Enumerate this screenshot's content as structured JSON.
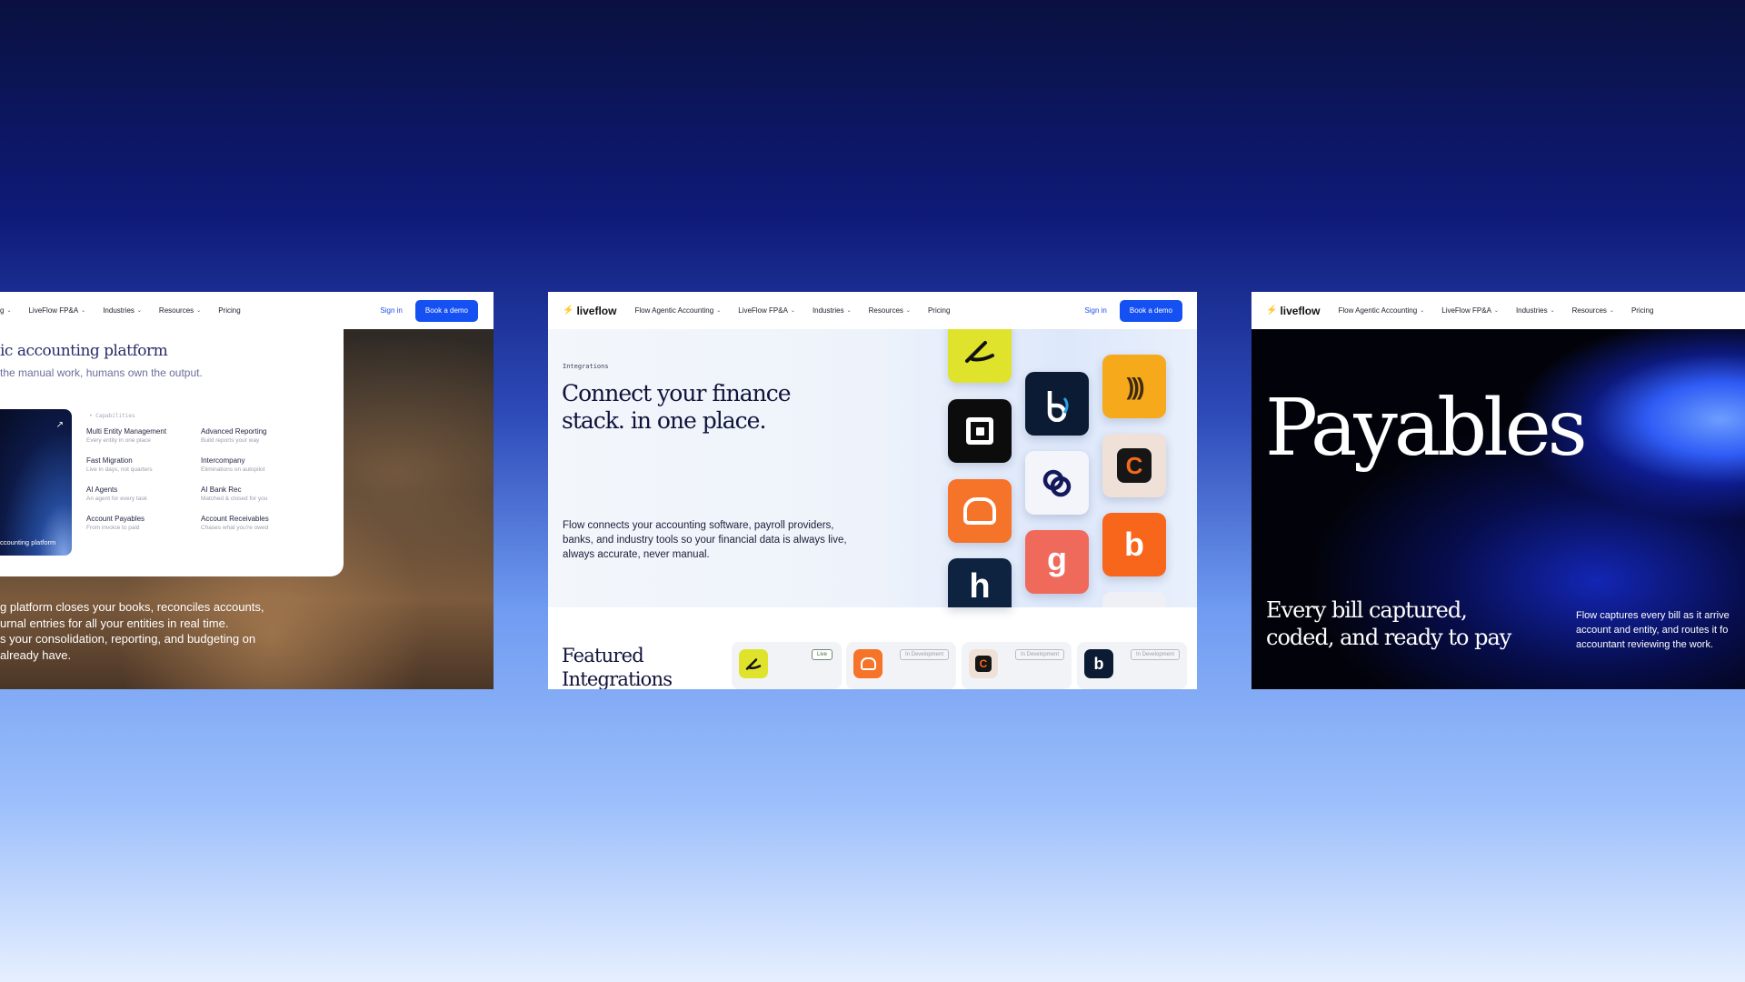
{
  "left_shot": {
    "nav": {
      "items": [
        "g",
        "LiveFlow FP&A",
        "Industries",
        "Resources",
        "Pricing"
      ],
      "signin": "Sign in",
      "cta": "Book a demo"
    },
    "menu": {
      "heading": "ic accounting platform",
      "subheading": "the manual work, humans own the output.",
      "section_label": "• Capabilities",
      "capabilities": [
        {
          "title": "Multi Entity Management",
          "sub": "Every entity in one place"
        },
        {
          "title": "Advanced Reporting",
          "sub": "Build reports your way"
        },
        {
          "title": "Fast Migration",
          "sub": "Live in days, not quarters"
        },
        {
          "title": "Intercompany",
          "sub": "Eliminations on autopilot"
        },
        {
          "title": "AI Agents",
          "sub": "An agent for every task"
        },
        {
          "title": "AI Bank Rec",
          "sub": "Matched & closed for you"
        },
        {
          "title": "Account Payables",
          "sub": "From invoice to paid"
        },
        {
          "title": "Account Receivables",
          "sub": "Chases what you're owed"
        }
      ],
      "promo_caption": "ccounting platform",
      "promo_icon": "arrow-up-right-icon"
    },
    "body_lines": [
      "g platform closes your books, reconciles accounts,",
      "urnal entries for all your entities in real time.",
      "s your consolidation, reporting, and budgeting on",
      "already have."
    ]
  },
  "center_shot": {
    "nav": {
      "logo": "liveflow",
      "items": [
        "Flow Agentic Accounting",
        "LiveFlow FP&A",
        "Industries",
        "Resources",
        "Pricing"
      ],
      "signin": "Sign in",
      "cta": "Book a demo"
    },
    "eyebrow": "Integrations",
    "headline_1": "Connect your finance",
    "headline_2": "stack. in one place.",
    "description": "Flow connects your accounting software, payroll providers, banks, and industry tools so your financial data is always live, always accurate, never manual.",
    "featured_1": "Featured",
    "featured_2": "Integrations",
    "cards": [
      {
        "icon": "swoosh-app-icon",
        "status": "Live"
      },
      {
        "icon": "toast-app-icon",
        "status": "In Development"
      },
      {
        "icon": "c-app-icon",
        "status": "In Development"
      },
      {
        "icon": "b-app-icon",
        "status": "In Development"
      }
    ]
  },
  "right_shot": {
    "nav": {
      "logo": "liveflow",
      "items": [
        "Flow Agentic Accounting",
        "LiveFlow FP&A",
        "Industries",
        "Resources",
        "Pricing"
      ]
    },
    "title": "Payables",
    "tagline_1": "Every bill captured,",
    "tagline_2": "coded, and ready to pay",
    "description_lines": [
      "Flow captures every bill as it arrive",
      "account and entity, and routes it fo",
      "accountant reviewing the work."
    ]
  },
  "colors": {
    "accent": "#1550f2",
    "navy": "#0a1140"
  }
}
